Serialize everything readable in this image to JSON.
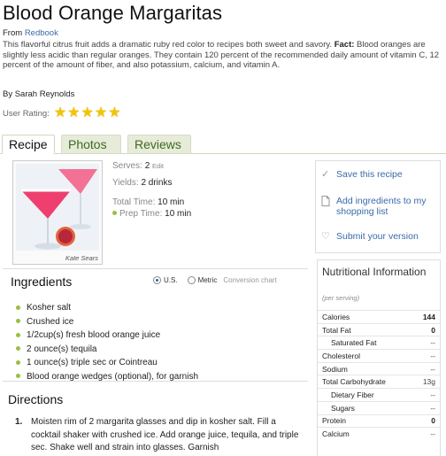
{
  "title": "Blood Orange Margaritas",
  "source": {
    "prefix": "From ",
    "name": "Redbook"
  },
  "intro": {
    "text": "This flavorful citrus fruit adds a dramatic ruby red color to recipes both sweet and savory. ",
    "fact_label": "Fact:",
    "fact_text": " Blood oranges are slightly less acidic than regular oranges. They contain 120 percent of the recommended daily amount of vitamin C, 12 percent of the amount of fiber, and also potassium, calcium, and vitamin A."
  },
  "byline": "By Sarah Reynolds",
  "rating": {
    "label": "User Rating:",
    "stars": 5
  },
  "tabs": [
    {
      "label": "Recipe",
      "active": true
    },
    {
      "label": "Photos",
      "active": false
    },
    {
      "label": "Reviews",
      "active": false
    }
  ],
  "photo_credit": "Kate Sears",
  "meta": {
    "serves_label": "Serves:",
    "serves_value": "2",
    "edit_label": "Edit",
    "yields_label": "Yields:",
    "yields_value": "2 drinks",
    "total_label": "Total Time:",
    "total_value": "10 min",
    "prep_label": "Prep Time:",
    "prep_value": "10 min"
  },
  "actions": [
    {
      "label": "Save this recipe",
      "icon": "checkmark-icon"
    },
    {
      "label": "Add ingredients to my shopping list",
      "icon": "document-icon"
    },
    {
      "label": "Submit your version",
      "icon": "heart-icon"
    }
  ],
  "ingredients": {
    "heading": "Ingredients",
    "unit_us": "U.S.",
    "unit_metric": "Metric",
    "selected_unit": "U.S.",
    "conversion": "Conversion chart",
    "items": [
      "Kosher salt",
      "Crushed ice",
      "1/2cup(s) fresh blood orange juice",
      "2 ounce(s) tequila",
      "1 ounce(s) triple sec or Cointreau",
      "Blood orange wedges (optional), for garnish"
    ]
  },
  "directions": {
    "heading": "Directions",
    "steps": [
      {
        "num": "1.",
        "text": "Moisten rim of 2 margarita glasses and dip in kosher salt. Fill a cocktail shaker with crushed ice. Add orange juice, tequila, and triple sec. Shake well and strain into glasses. Garnish"
      }
    ]
  },
  "nutrition": {
    "heading": "Nutritional Information",
    "sub": "(per serving)",
    "rows": [
      {
        "label": "Calories",
        "value": "144",
        "indent": false
      },
      {
        "label": "Total Fat",
        "value": "0",
        "indent": false
      },
      {
        "label": "Saturated Fat",
        "value": "--",
        "indent": true
      },
      {
        "label": "Cholesterol",
        "value": "--",
        "indent": false
      },
      {
        "label": "Sodium",
        "value": "--",
        "indent": false
      },
      {
        "label": "Total Carbohydrate",
        "value": "13g",
        "indent": false
      },
      {
        "label": "Dietary Fiber",
        "value": "--",
        "indent": true
      },
      {
        "label": "Sugars",
        "value": "--",
        "indent": true
      },
      {
        "label": "Protein",
        "value": "0",
        "indent": false
      },
      {
        "label": "Calcium",
        "value": "--",
        "indent": false
      }
    ]
  },
  "colors": {
    "link": "#3a6aa8",
    "tab_text": "#3d6b1f",
    "bullet": "#9bbf3e",
    "star": "#f5c400"
  }
}
